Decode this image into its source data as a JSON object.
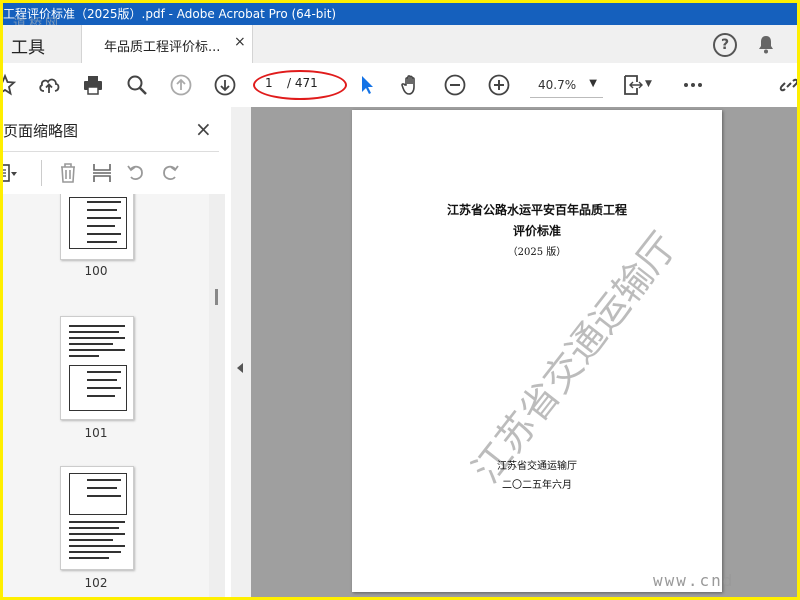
{
  "window": {
    "title": "工程评价标准（2025版）.pdf - Adobe Acrobat Pro (64-bit)",
    "watermark": "道桥网"
  },
  "tabs": {
    "tools": "工具",
    "document": "年品质工程评价标...",
    "close": "×"
  },
  "toolbar": {
    "page_current": "1",
    "page_total": "/ 471",
    "zoom": "40.7%",
    "icons": [
      "star-icon",
      "upload-icon",
      "print-icon",
      "search-icon",
      "page-up-icon",
      "page-down-icon",
      "select-arrow-icon",
      "hand-icon",
      "zoom-out-icon",
      "zoom-in-icon",
      "fit-page-icon",
      "more-icon",
      "link-icon"
    ]
  },
  "sidebar": {
    "title": "页面缩略图",
    "close": "×",
    "thumbnails": [
      {
        "label": "100"
      },
      {
        "label": "101"
      },
      {
        "label": "102"
      }
    ]
  },
  "document": {
    "title_line1": "江苏省公路水运平安百年品质工程",
    "title_line2": "评价标准",
    "edition": "（2025 版）",
    "author": "江苏省交通运输厅",
    "date": "二〇二五年六月",
    "stamp": "江苏省交通运输厅"
  },
  "corner_watermark": "www.cnd",
  "colors": {
    "titlebar": "#1560bd",
    "annotation": "#e01b1b",
    "frame": "#ffef00",
    "select_tool": "#1473e6"
  }
}
